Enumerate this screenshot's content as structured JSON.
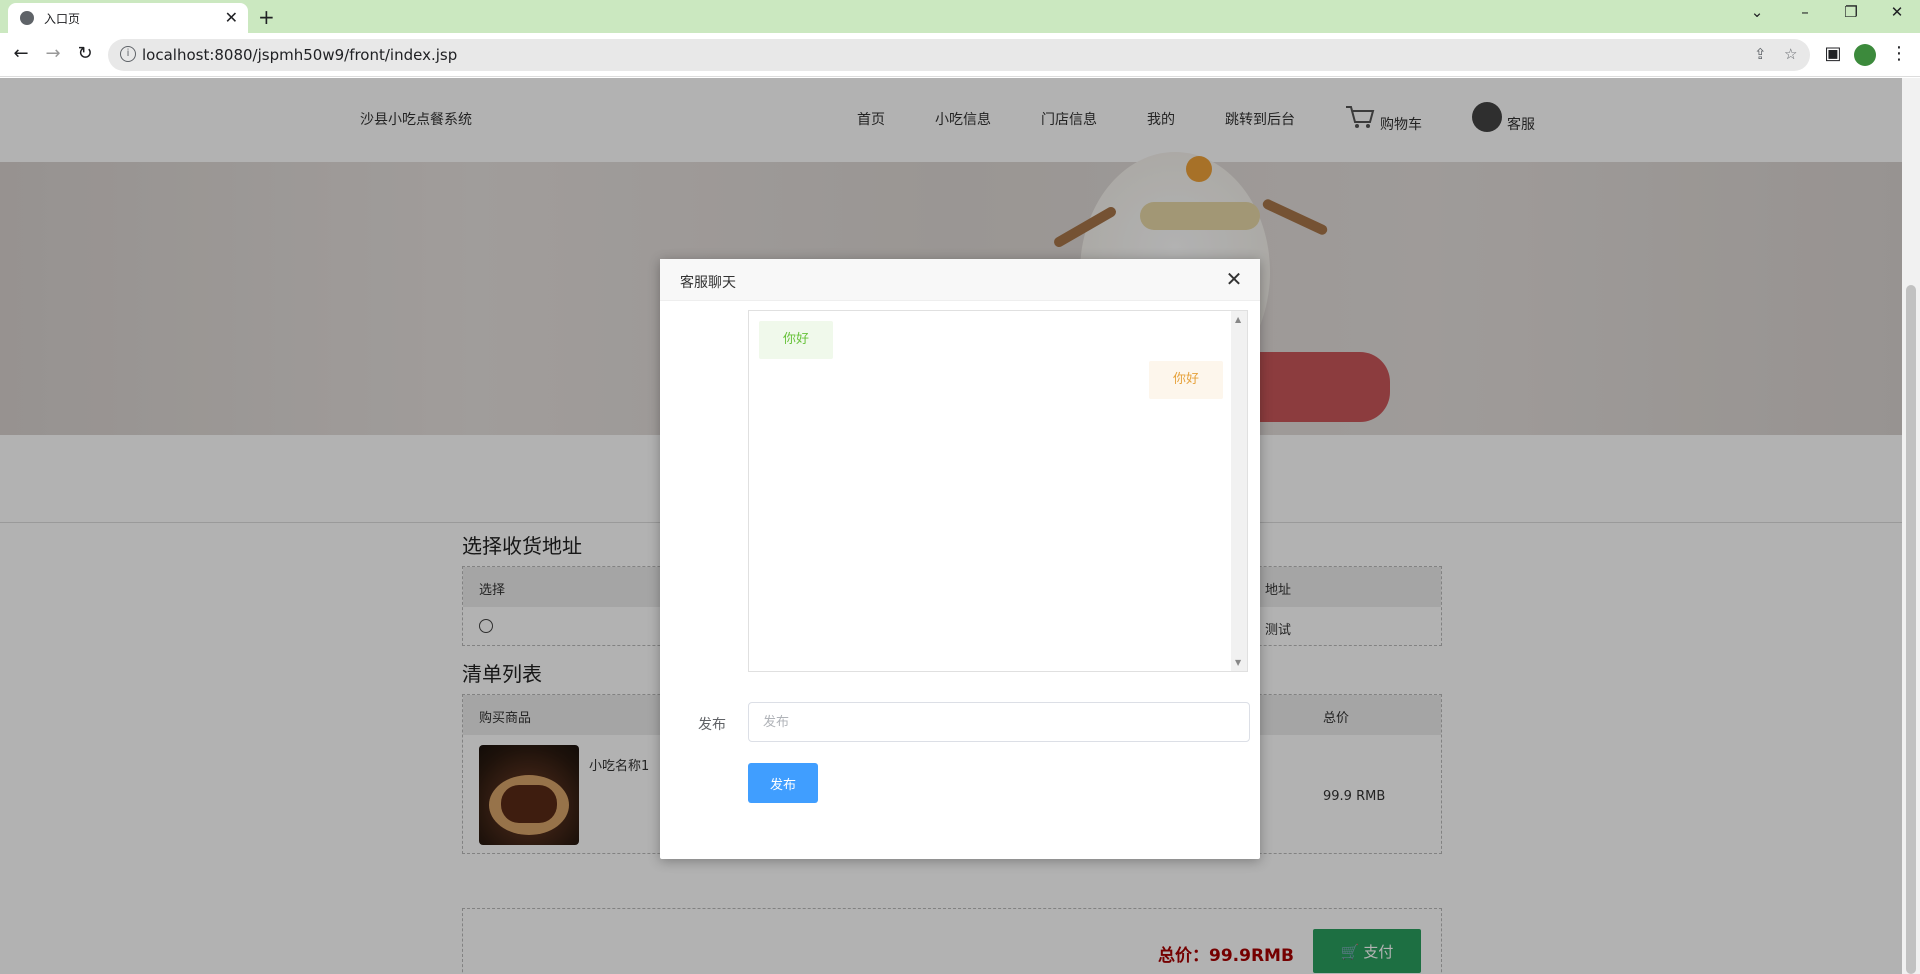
{
  "browser": {
    "tab_title": "入口页",
    "url": "localhost:8080/jspmh50w9/front/index.jsp"
  },
  "header": {
    "site_title": "沙县小吃点餐系统",
    "nav": [
      "首页",
      "小吃信息",
      "门店信息",
      "我的",
      "跳转到后台"
    ],
    "cart_label": "购物车",
    "service_label": "客服"
  },
  "address": {
    "title": "选择收货地址",
    "col_select": "选择",
    "col_address": "地址",
    "row_address": "测试"
  },
  "orders": {
    "title": "清单列表",
    "col_goods": "购买商品",
    "col_total": "总价",
    "item_name": "小吃名称1",
    "item_total": "99.9 RMB"
  },
  "payment": {
    "total_text": "总价：99.9RMB",
    "pay_label": "支付"
  },
  "dialog": {
    "title": "客服聊天",
    "messages": [
      {
        "side": "left",
        "text": "你好"
      },
      {
        "side": "right",
        "text": "你好"
      }
    ],
    "input_label": "发布",
    "input_placeholder": "发布",
    "submit_label": "发布"
  },
  "colors": {
    "tab_strip": "#cbe8c0",
    "pay_button": "#2aa05f",
    "primary_button": "#409eff",
    "total_price": "#a80000"
  }
}
